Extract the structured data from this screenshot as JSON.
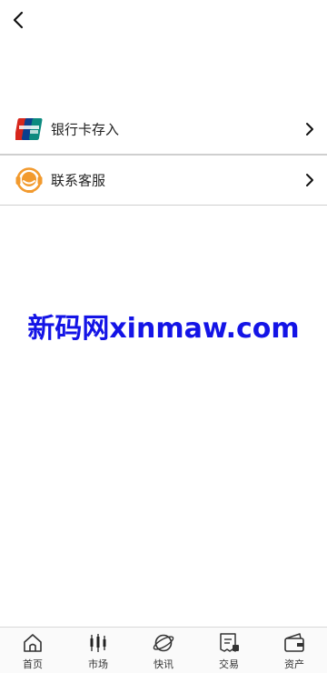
{
  "header": {
    "back_icon": "chevron-left-icon"
  },
  "menu": {
    "items": [
      {
        "icon": "unionpay-icon",
        "label": "银行卡存入",
        "arrow_icon": "chevron-right-icon"
      },
      {
        "icon": "customer-service-icon",
        "label": "联系客服",
        "arrow_icon": "chevron-right-icon"
      }
    ]
  },
  "watermark": {
    "text": "新码网xinmaw.com",
    "color": "#1414e6"
  },
  "tabbar": {
    "tabs": [
      {
        "label": "首页",
        "icon": "home-icon"
      },
      {
        "label": "市场",
        "icon": "candlestick-icon"
      },
      {
        "label": "快讯",
        "icon": "planet-icon"
      },
      {
        "label": "交易",
        "icon": "receipt-icon"
      },
      {
        "label": "资产",
        "icon": "wallet-icon"
      }
    ]
  }
}
